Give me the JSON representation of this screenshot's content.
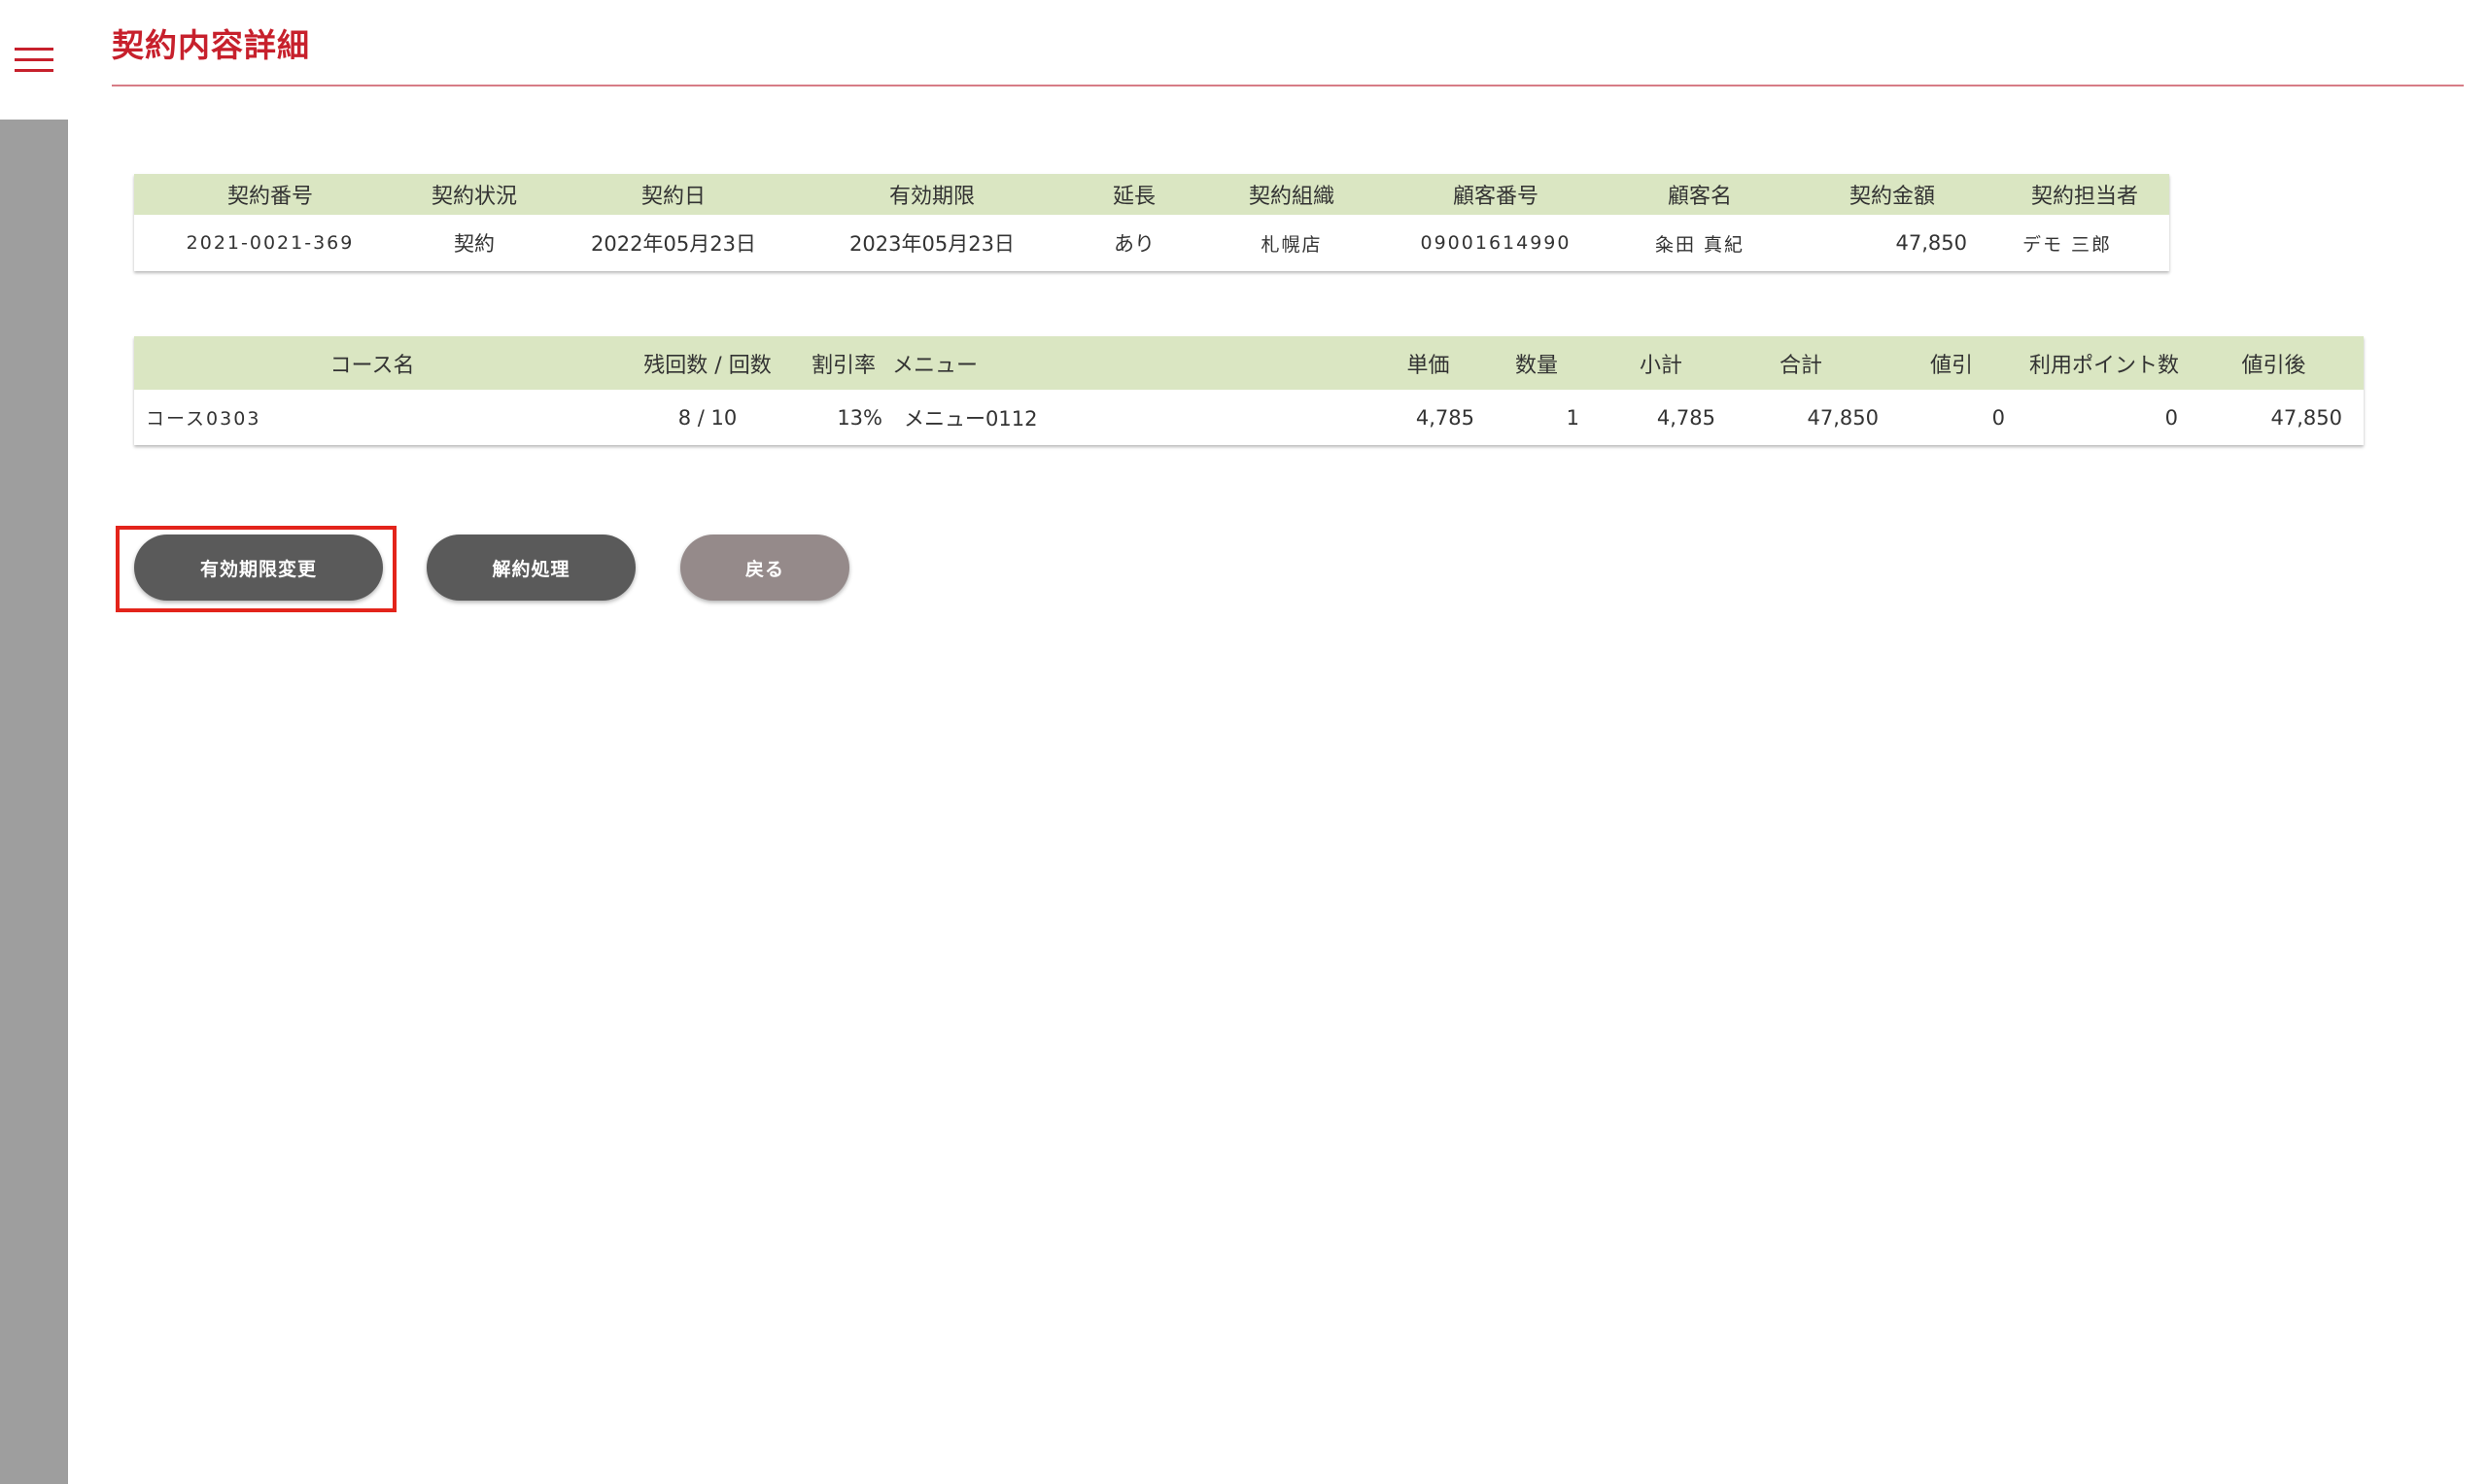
{
  "page": {
    "title": "契約内容詳細"
  },
  "icons": {
    "menu": "hamburger-menu-icon"
  },
  "colors": {
    "accent": "#c7202c",
    "table_header_bg": "#dae6c2",
    "sidebar": "#9e9e9e",
    "button_dark": "#5a5a5a",
    "button_light": "#958a8a",
    "highlight": "#e3241b"
  },
  "contract_table": {
    "headers": [
      "契約番号",
      "契約状況",
      "契約日",
      "有効期限",
      "延長",
      "契約組織",
      "顧客番号",
      "顧客名",
      "契約金額",
      "契約担当者"
    ],
    "row": [
      "2021-0021-369",
      "契約",
      "2022年05月23日",
      "2023年05月23日",
      "あり",
      "札幌店",
      "09001614990",
      "粂田 真紀",
      "47,850",
      "デモ 三郎"
    ]
  },
  "course_table": {
    "headers": [
      "コース名",
      "残回数 / 回数",
      "割引率",
      "メニュー",
      "単価",
      "数量",
      "小計",
      "合計",
      "値引",
      "利用ポイント数",
      "値引後"
    ],
    "row": [
      "コース0303",
      "8 / 10",
      "13%",
      "メニュー0112",
      "4,785",
      "1",
      "4,785",
      "47,850",
      "0",
      "0",
      "47,850"
    ]
  },
  "actions": {
    "change_expiry": "有効期限変更",
    "cancel_contract": "解約処理",
    "back": "戻る"
  }
}
